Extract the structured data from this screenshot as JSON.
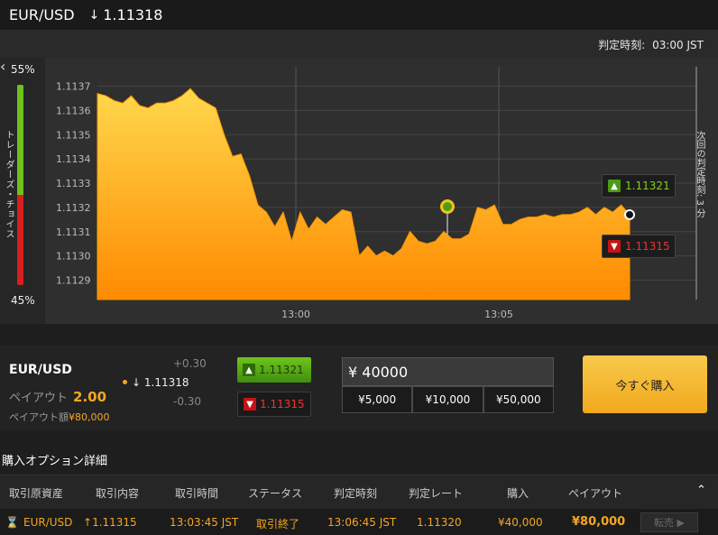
{
  "header": {
    "pair": "EUR/USD",
    "price": "1.11318",
    "direction_icon": "down-arrow-icon"
  },
  "expiry": {
    "label": "判定時刻:",
    "time": "03:00 JST"
  },
  "sentiment": {
    "top_pct": "55%",
    "bottom_pct": "45%",
    "label": "トレーダーズ・チョイス",
    "buy_color": "#6ec21b",
    "sell_color": "#d81e1e"
  },
  "chart": {
    "y_ticks": [
      "1.1137",
      "1.1136",
      "1.1135",
      "1.1134",
      "1.1133",
      "1.1132",
      "1.1131",
      "1.1130",
      "1.1129"
    ],
    "x_ticks": [
      "13:00",
      "13:05"
    ],
    "high_tag": "1.11321",
    "low_tag": "1.11315",
    "next_expiry_label": "次回の判定時刻: 3 分",
    "fill_color": "#f7931e"
  },
  "chart_data": {
    "type": "area",
    "title": "",
    "xlabel": "",
    "ylabel": "",
    "ylim": [
      1.11282,
      1.11378
    ],
    "x_ticks": [
      "13:00",
      "13:05"
    ],
    "y": [
      1.11367,
      1.11366,
      1.11364,
      1.11363,
      1.11366,
      1.11362,
      1.11361,
      1.11363,
      1.11363,
      1.11364,
      1.11366,
      1.11369,
      1.11365,
      1.11363,
      1.11361,
      1.1135,
      1.11341,
      1.11342,
      1.11333,
      1.11321,
      1.11318,
      1.11312,
      1.11318,
      1.11306,
      1.11318,
      1.11311,
      1.11316,
      1.11313,
      1.11316,
      1.11319,
      1.11318,
      1.113,
      1.11304,
      1.113,
      1.11302,
      1.113,
      1.11303,
      1.1131,
      1.11306,
      1.11305,
      1.11306,
      1.1131,
      1.11307,
      1.11307,
      1.11309,
      1.1132,
      1.11319,
      1.11321,
      1.11313,
      1.11313,
      1.11315,
      1.11316,
      1.11316,
      1.11317,
      1.11316,
      1.11317,
      1.11317,
      1.11318,
      1.1132,
      1.11317,
      1.1132,
      1.11318,
      1.11321,
      1.11317
    ]
  },
  "trade": {
    "pair": "EUR/USD",
    "payout_label": "ペイアウト",
    "payout_value": "2.00",
    "payout_amount_label": "ペイアウト額",
    "payout_amount": "¥80,000",
    "plus": "+0.30",
    "minus": "-0.30",
    "current": "1.11318",
    "high_btn": "1.11321",
    "low_btn": "1.11315",
    "amount": "¥ 40000",
    "presets": [
      "¥5,000",
      "¥10,000",
      "¥50,000"
    ],
    "buy_now": "今すぐ購入"
  },
  "details": {
    "title": "購入オプション詳細",
    "columns": [
      "取引原資産",
      "取引内容",
      "取引時間",
      "ステータス",
      "判定時刻",
      "判定レート",
      "購入",
      "ペイアウト"
    ],
    "collapse_icon": "double-chevron-up-icon",
    "row": {
      "asset": "EUR/USD",
      "type": "1.11315",
      "time": "13:03:45 JST",
      "status": "取引終了",
      "expiry": "13:06:45 JST",
      "rate": "1.11320",
      "purchase": "¥40,000",
      "payout": "¥80,000",
      "sell_label": "転売"
    }
  }
}
